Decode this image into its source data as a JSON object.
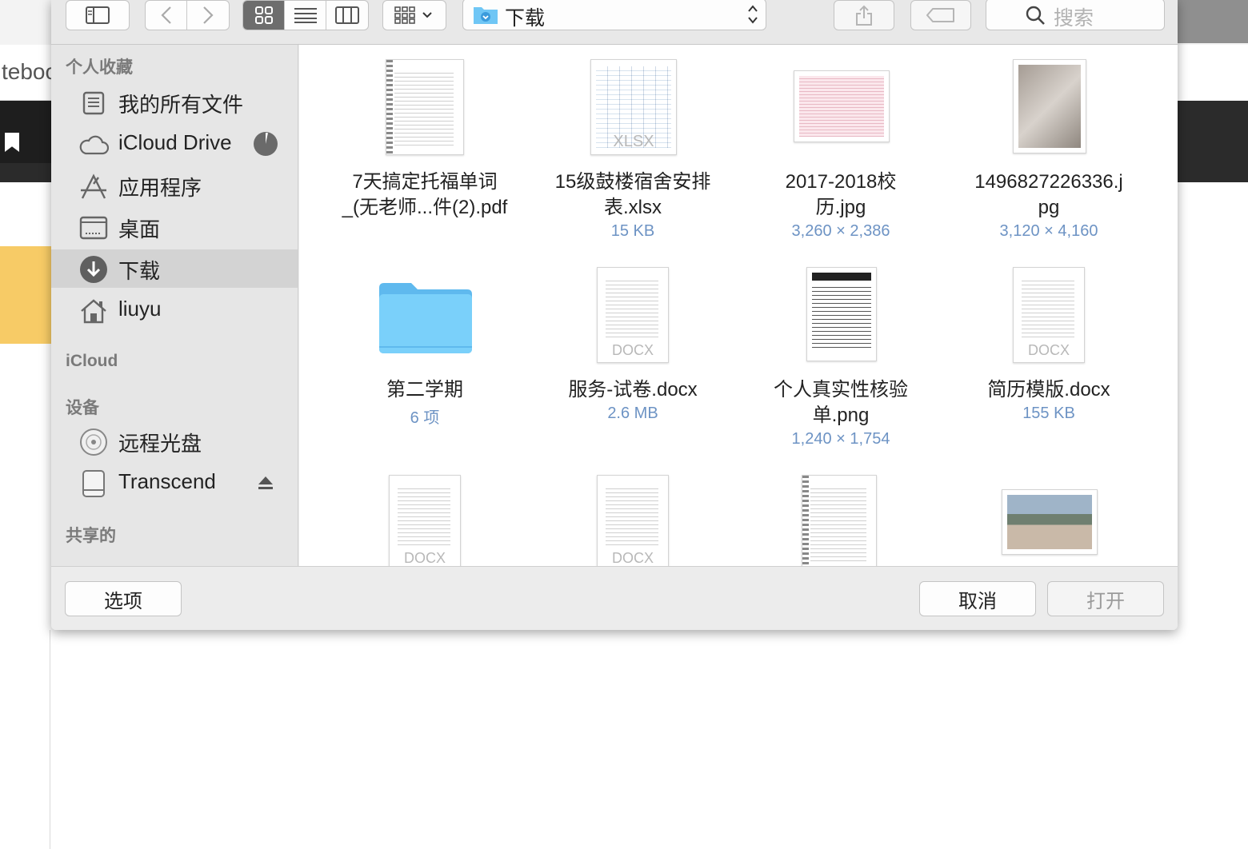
{
  "background": {
    "url_fragment": "teboo"
  },
  "toolbar": {
    "location": "下载",
    "search_placeholder": "搜索"
  },
  "sidebar": {
    "favorites_header": "个人收藏",
    "favorites": [
      {
        "label": "我的所有文件",
        "icon": "all-files-icon"
      },
      {
        "label": "iCloud Drive",
        "icon": "cloud-icon"
      },
      {
        "label": "应用程序",
        "icon": "applications-icon"
      },
      {
        "label": "桌面",
        "icon": "desktop-icon"
      },
      {
        "label": "下载",
        "icon": "downloads-icon"
      },
      {
        "label": "liuyu",
        "icon": "home-icon"
      }
    ],
    "icloud_header": "iCloud",
    "devices_header": "设备",
    "devices": [
      {
        "label": "远程光盘",
        "icon": "disc-icon"
      },
      {
        "label": "Transcend",
        "icon": "drive-icon"
      }
    ],
    "shared_header": "共享的"
  },
  "files": [
    {
      "name": "7天搞定托福单词\n_(无老师...件(2).pdf",
      "meta": ""
    },
    {
      "name": "15级鼓楼宿舍安排\n表.xlsx",
      "meta": "15 KB"
    },
    {
      "name": "2017-2018校\n历.jpg",
      "meta": "3,260 × 2,386"
    },
    {
      "name": "1496827226336.j\npg",
      "meta": "3,120 × 4,160"
    },
    {
      "name": "第二学期",
      "meta": "6 项"
    },
    {
      "name": "服务-试卷.docx",
      "meta": "2.6 MB"
    },
    {
      "name": "个人真实性核验\n单.png",
      "meta": "1,240 × 1,754"
    },
    {
      "name": "简历模版.docx",
      "meta": "155 KB"
    }
  ],
  "thumb_labels": {
    "docx": "DOCX",
    "xlsx": "XLSX"
  },
  "buttons": {
    "options": "选项",
    "cancel": "取消",
    "open": "打开"
  },
  "colors": {
    "selection": "#d3d3d3",
    "meta_text": "#6d93c4",
    "folder": "#6fc6f5"
  }
}
